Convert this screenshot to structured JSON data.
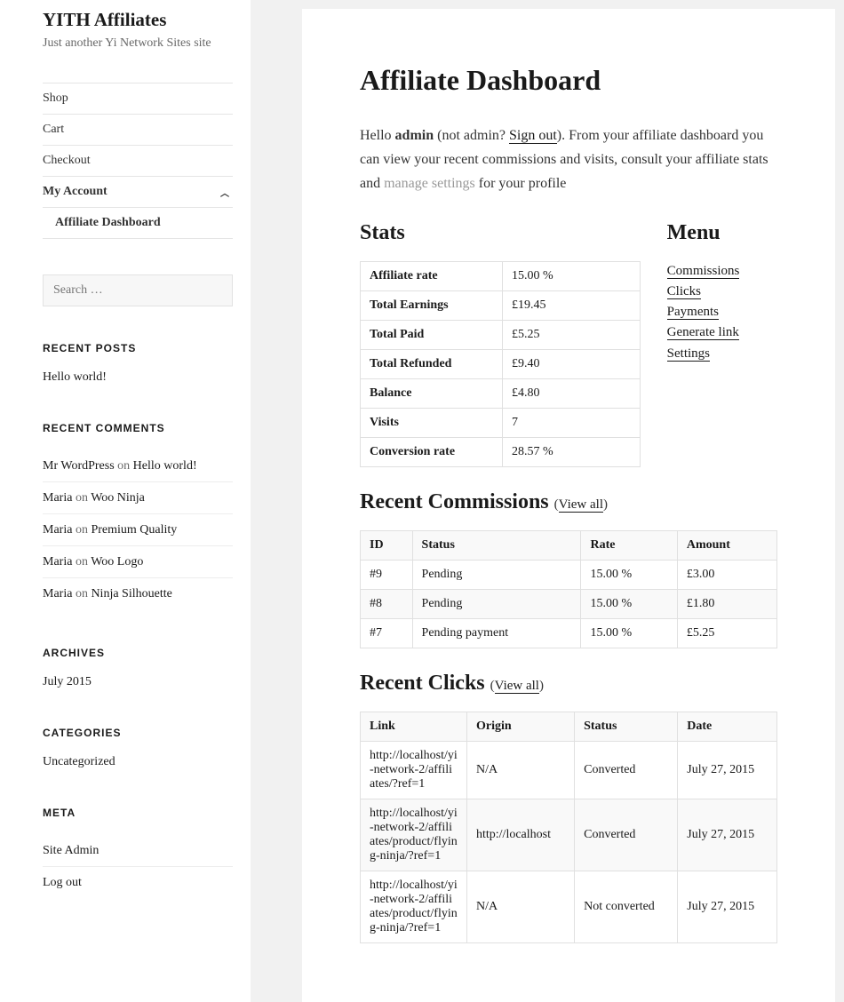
{
  "site": {
    "title": "YITH Affiliates",
    "desc": "Just another Yi Network Sites site"
  },
  "nav": {
    "shop": "Shop",
    "cart": "Cart",
    "checkout": "Checkout",
    "my_account": "My Account",
    "affiliate_dashboard": "Affiliate Dashboard"
  },
  "search": {
    "placeholder": "Search …"
  },
  "widgets": {
    "recent_posts": {
      "title": "RECENT POSTS",
      "item1": "Hello world!"
    },
    "recent_comments": {
      "title": "RECENT COMMENTS",
      "c1a": "Mr WordPress",
      "c1p": "Hello world!",
      "c2a": "Maria",
      "c2p": "Woo Ninja",
      "c3a": "Maria",
      "c3p": "Premium Quality",
      "c4a": "Maria",
      "c4p": "Woo Logo",
      "c5a": "Maria",
      "c5p": "Ninja Silhouette",
      "on": " on "
    },
    "archives": {
      "title": "ARCHIVES",
      "item1": "July 2015"
    },
    "categories": {
      "title": "CATEGORIES",
      "item1": "Uncategorized"
    },
    "meta": {
      "title": "META",
      "item1": "Site Admin",
      "item2": "Log out"
    }
  },
  "page": {
    "title": "Affiliate Dashboard",
    "hello": "Hello ",
    "user": "admin",
    "not_prefix": " (not admin? ",
    "signout": "Sign out",
    "after1": "). From your affiliate dashboard you can view your recent commissions and visits, consult your affiliate stats and ",
    "manage": "manage settings",
    "after2": " for your profile"
  },
  "stats": {
    "title": "Stats",
    "r1l": "Affiliate rate",
    "r1v": "15.00 %",
    "r2l": "Total Earnings",
    "r2v": "£19.45",
    "r3l": "Total Paid",
    "r3v": "£5.25",
    "r4l": "Total Refunded",
    "r4v": "£9.40",
    "r5l": "Balance",
    "r5v": "£4.80",
    "r6l": "Visits",
    "r6v": "7",
    "r7l": "Conversion rate",
    "r7v": "28.57 %"
  },
  "menu": {
    "title": "Menu",
    "i1": "Commissions",
    "i2": "Clicks",
    "i3": "Payments",
    "i4": "Generate link",
    "i5": "Settings"
  },
  "commissions": {
    "title": "Recent Commissions",
    "viewall": "View all",
    "h1": "ID",
    "h2": "Status",
    "h3": "Rate",
    "h4": "Amount",
    "r1c1": "#9",
    "r1c2": "Pending",
    "r1c3": "15.00 %",
    "r1c4": "£3.00",
    "r2c1": "#8",
    "r2c2": "Pending",
    "r2c3": "15.00 %",
    "r2c4": "£1.80",
    "r3c1": "#7",
    "r3c2": "Pending payment",
    "r3c3": "15.00 %",
    "r3c4": "£5.25"
  },
  "clicks": {
    "title": "Recent Clicks",
    "viewall": "View all",
    "h1": "Link",
    "h2": "Origin",
    "h3": "Status",
    "h4": "Date",
    "r1c1": "http://localhost/yi-network-2/affiliates/?ref=1",
    "r1c2": "N/A",
    "r1c3": "Converted",
    "r1c4": "July 27, 2015",
    "r2c1": "http://localhost/yi-network-2/affiliates/product/flying-ninja/?ref=1",
    "r2c2": "http://localhost",
    "r2c3": "Converted",
    "r2c4": "July 27, 2015",
    "r3c1": "http://localhost/yi-network-2/affiliates/product/flying-ninja/?ref=1",
    "r3c2": "N/A",
    "r3c3": "Not converted",
    "r3c4": "July 27, 2015"
  },
  "paren_open": "(",
  "paren_close": ")"
}
